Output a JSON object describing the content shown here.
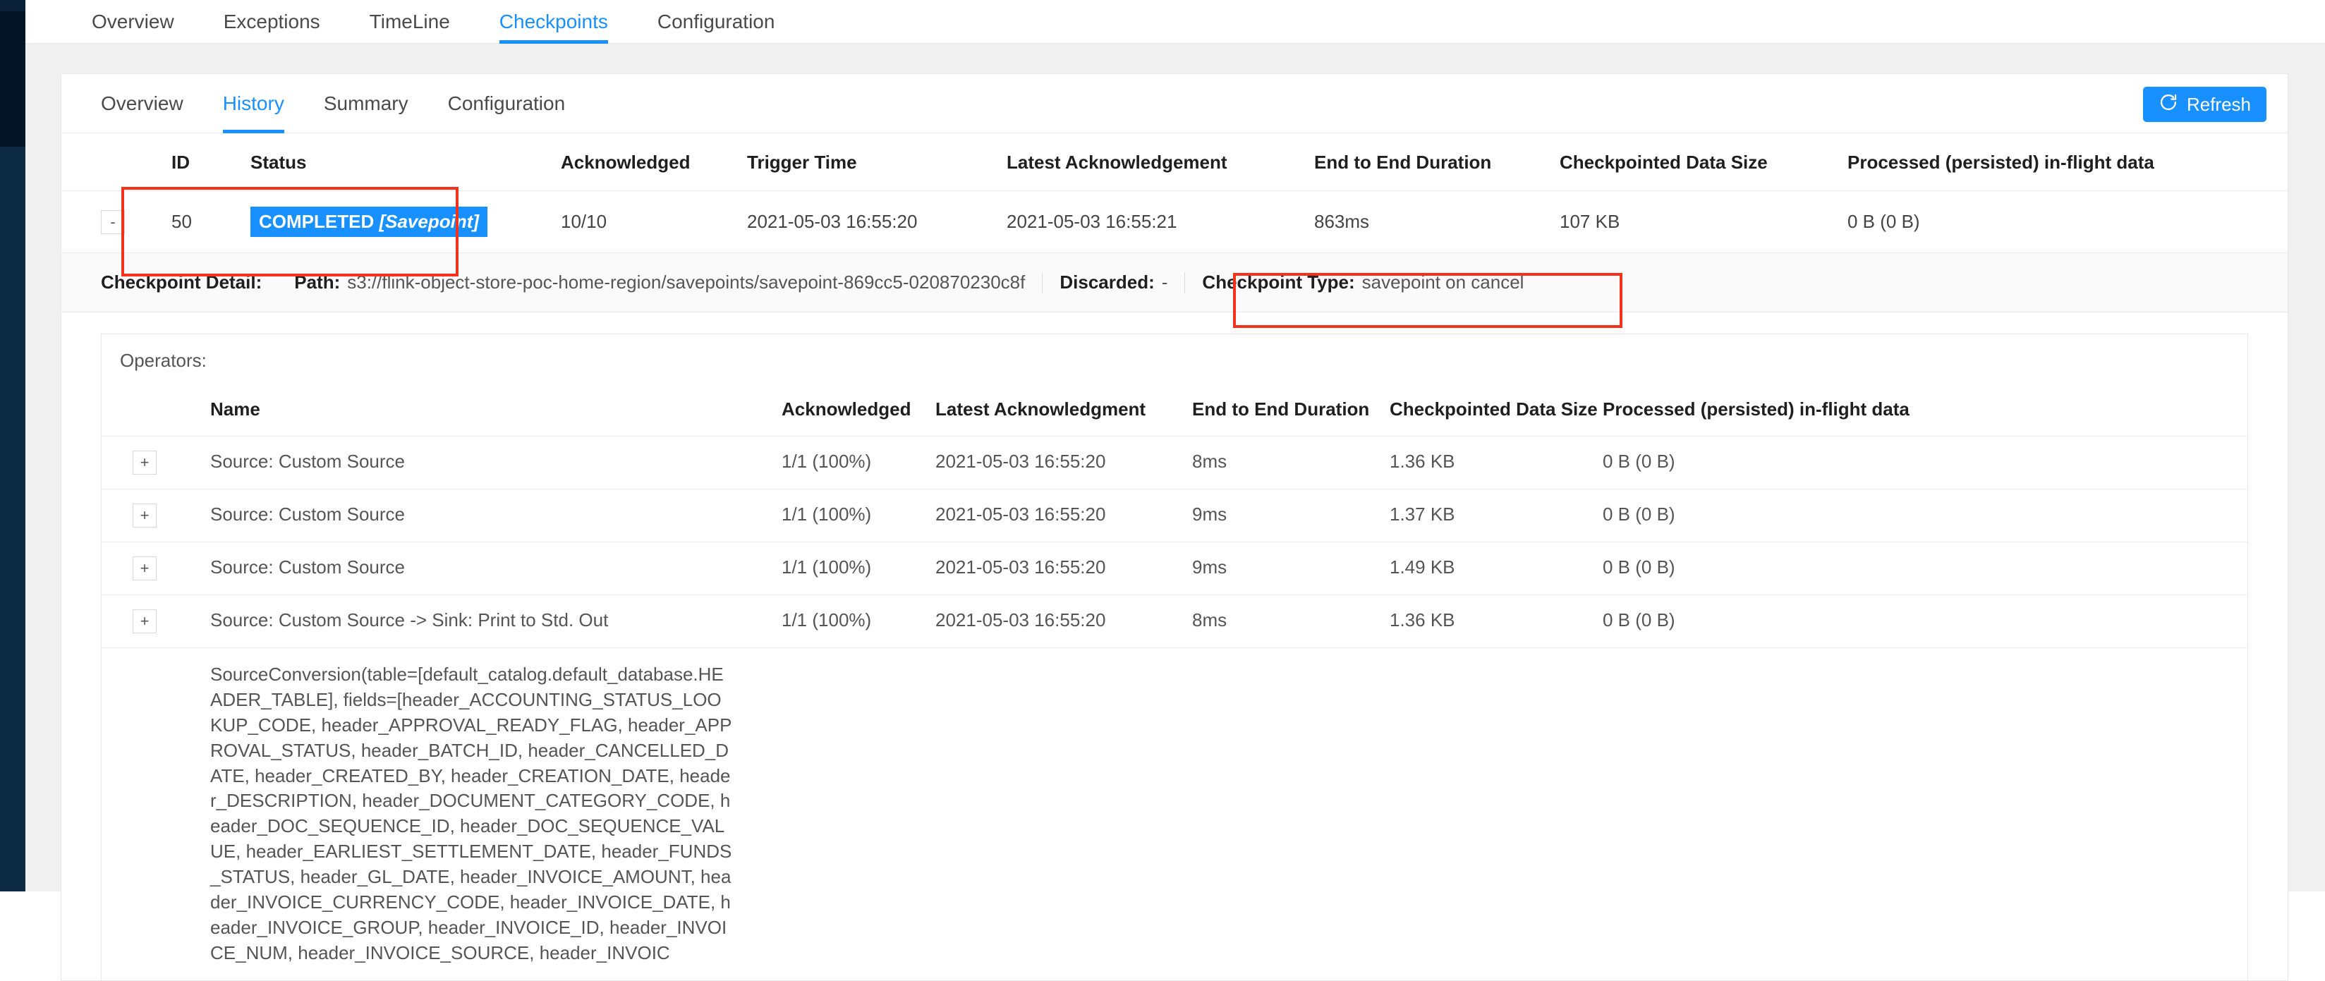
{
  "top_nav": {
    "items": [
      {
        "label": "Overview",
        "active": false
      },
      {
        "label": "Exceptions",
        "active": false
      },
      {
        "label": "TimeLine",
        "active": false
      },
      {
        "label": "Checkpoints",
        "active": true
      },
      {
        "label": "Configuration",
        "active": false
      }
    ]
  },
  "sub_nav": {
    "items": [
      {
        "label": "Overview",
        "active": false
      },
      {
        "label": "History",
        "active": true
      },
      {
        "label": "Summary",
        "active": false
      },
      {
        "label": "Configuration",
        "active": false
      }
    ],
    "refresh_label": "Refresh",
    "refresh_icon": "refresh-icon"
  },
  "accent_color": "#1890ff",
  "annotation_color": "#f4311b",
  "checkpoint_table": {
    "headers": [
      "",
      "ID",
      "Status",
      "Acknowledged",
      "Trigger Time",
      "Latest Acknowledgement",
      "End to End Duration",
      "Checkpointed Data Size",
      "Processed (persisted) in-flight data"
    ],
    "rows": [
      {
        "expander": "-",
        "id": "50",
        "status_main": "COMPLETED",
        "status_tag": "[Savepoint]",
        "acknowledged": "10/10",
        "trigger_time": "2021-05-03 16:55:20",
        "latest_acknowledgement": "2021-05-03 16:55:21",
        "end_to_end_duration": "863ms",
        "checkpointed_data_size": "107 KB",
        "in_flight_data": "0 B (0 B)"
      }
    ]
  },
  "checkpoint_detail": {
    "label": "Checkpoint Detail:",
    "path_label": "Path:",
    "path_value": "s3://flink-object-store-poc-home-region/savepoints/savepoint-869cc5-020870230c8f",
    "discarded_label": "Discarded:",
    "discarded_value": "-",
    "type_label": "Checkpoint Type:",
    "type_value": "savepoint on cancel"
  },
  "operators": {
    "title": "Operators:",
    "headers": [
      "",
      "Name",
      "Acknowledged",
      "Latest Acknowledgment",
      "End to End Duration",
      "Checkpointed Data Size",
      "Processed (persisted) in-flight data"
    ],
    "rows": [
      {
        "expander": "+",
        "name": "Source: Custom Source",
        "acknowledged": "1/1 (100%)",
        "latest_acknowledgment": "2021-05-03 16:55:20",
        "end_to_end_duration": "8ms",
        "checkpointed_data_size": "1.36 KB",
        "in_flight_data": "0 B (0 B)"
      },
      {
        "expander": "+",
        "name": "Source: Custom Source",
        "acknowledged": "1/1 (100%)",
        "latest_acknowledgment": "2021-05-03 16:55:20",
        "end_to_end_duration": "9ms",
        "checkpointed_data_size": "1.37 KB",
        "in_flight_data": "0 B (0 B)"
      },
      {
        "expander": "+",
        "name": "Source: Custom Source",
        "acknowledged": "1/1 (100%)",
        "latest_acknowledgment": "2021-05-03 16:55:20",
        "end_to_end_duration": "9ms",
        "checkpointed_data_size": "1.49 KB",
        "in_flight_data": "0 B (0 B)"
      },
      {
        "expander": "+",
        "name": "Source: Custom Source -> Sink: Print to Std. Out",
        "acknowledged": "1/1 (100%)",
        "latest_acknowledgment": "2021-05-03 16:55:20",
        "end_to_end_duration": "8ms",
        "checkpointed_data_size": "1.36 KB",
        "in_flight_data": "0 B (0 B)"
      },
      {
        "expander": "",
        "name": "SourceConversion(table=[default_catalog.default_database.HEADER_TABLE], fields=[header_ACCOUNTING_STATUS_LOOKUP_CODE, header_APPROVAL_READY_FLAG, header_APPROVAL_STATUS, header_BATCH_ID, header_CANCELLED_DATE, header_CREATED_BY, header_CREATION_DATE, header_DESCRIPTION, header_DOCUMENT_CATEGORY_CODE, header_DOC_SEQUENCE_ID, header_DOC_SEQUENCE_VALUE, header_EARLIEST_SETTLEMENT_DATE, header_FUNDS_STATUS, header_GL_DATE, header_INVOICE_AMOUNT, header_INVOICE_CURRENCY_CODE, header_INVOICE_DATE, header_INVOICE_GROUP, header_INVOICE_ID, header_INVOICE_NUM, header_INVOICE_SOURCE, header_INVOIC",
        "acknowledged": "",
        "latest_acknowledgment": "",
        "end_to_end_duration": "",
        "checkpointed_data_size": "",
        "in_flight_data": ""
      }
    ]
  }
}
